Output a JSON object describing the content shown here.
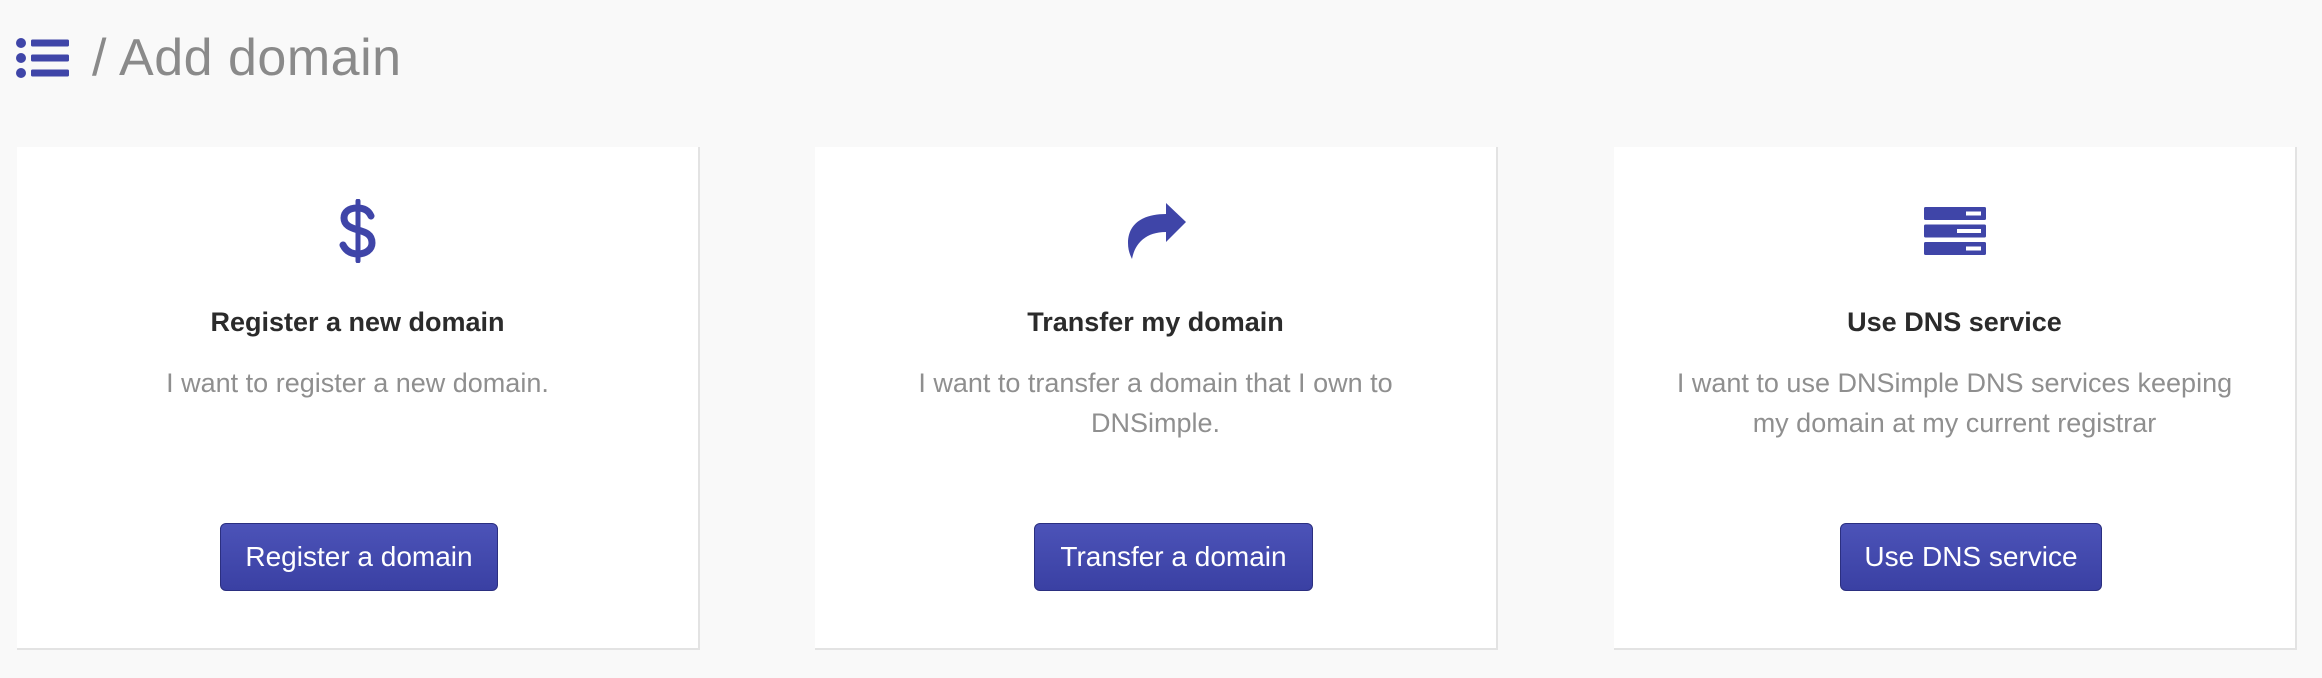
{
  "header": {
    "menu_icon": "list-icon",
    "title": "/ Add domain"
  },
  "colors": {
    "accent": "#3f45a8",
    "button_border": "#2b2f80",
    "title_gray": "#8a8a8a",
    "text_gray": "#8f8f8f",
    "background": "#f9f9f9",
    "card_background": "#ffffff"
  },
  "cards": [
    {
      "icon": "dollar-icon",
      "title": "Register a new domain",
      "description": "I want to register a new domain.",
      "button_label": "Register a domain"
    },
    {
      "icon": "share-arrow-icon",
      "title": "Transfer my domain",
      "description": "I want to transfer a domain that I own to DNSimple.",
      "button_label": "Transfer a domain"
    },
    {
      "icon": "server-icon",
      "title": "Use DNS service",
      "description": "I want to use DNSimple DNS services keeping my domain at my current registrar",
      "button_label": "Use DNS service"
    }
  ]
}
